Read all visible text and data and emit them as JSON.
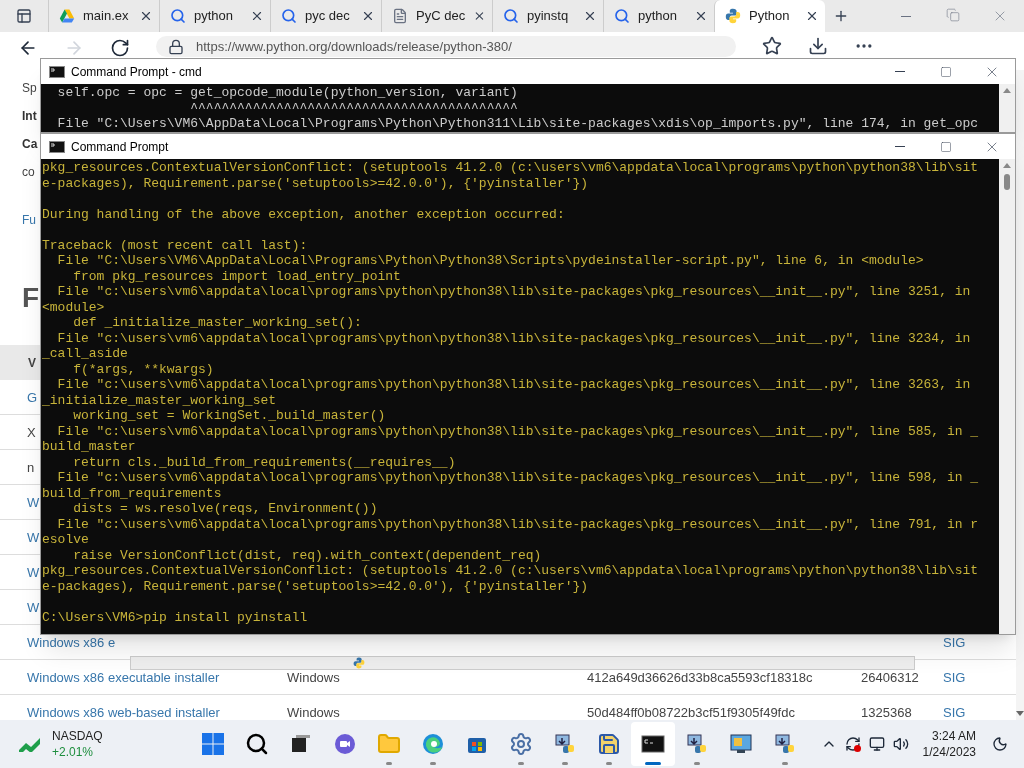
{
  "browser": {
    "tabs": [
      {
        "title": "main.ex",
        "kind": "drive",
        "selected": false
      },
      {
        "title": "python",
        "kind": "search",
        "selected": false
      },
      {
        "title": "pyc dec",
        "kind": "search",
        "selected": false
      },
      {
        "title": "PyC dec",
        "kind": "page",
        "selected": false
      },
      {
        "title": "pyinstq",
        "kind": "search",
        "selected": false
      },
      {
        "title": "python",
        "kind": "search",
        "selected": false
      },
      {
        "title": "Python",
        "kind": "python",
        "selected": true
      }
    ],
    "url": "https://www.python.org/downloads/release/python-380/",
    "page": {
      "paragraphs": [
        {
          "text": "Sp",
          "kind": "text"
        },
        {
          "text": "Int",
          "kind": "bold"
        },
        {
          "text": "Ca",
          "kind": "bold"
        },
        {
          "text": "co",
          "kind": "text"
        },
        {
          "text": "Fu",
          "kind": "link"
        }
      ],
      "heading": "F",
      "table": {
        "header": "V",
        "rows": [
          {
            "cells": [
              {
                "text": "G",
                "kind": "link"
              }
            ]
          },
          {
            "cells": [
              {
                "text": "X",
                "kind": "text"
              }
            ]
          },
          {
            "cells": [
              {
                "text": "n",
                "kind": "text"
              }
            ]
          },
          {
            "cells": [
              {
                "text": "W",
                "kind": "link"
              }
            ]
          },
          {
            "cells": [
              {
                "text": "W",
                "kind": "link"
              }
            ]
          },
          {
            "cells": [
              {
                "text": "W",
                "kind": "link"
              }
            ]
          },
          {
            "cells": [
              {
                "text": "W",
                "kind": "link"
              }
            ]
          },
          {
            "cells": [
              {
                "text": "Windows x86 e",
                "kind": "link"
              },
              {
                "text": "",
                "kind": "gap"
              },
              {
                "text": "",
                "kind": "gap"
              },
              {
                "text": "",
                "kind": "gap"
              },
              {
                "text": "",
                "kind": "gap"
              },
              {
                "text": "SIG",
                "kind": "link"
              }
            ]
          },
          {
            "cells": [
              {
                "text": "Windows x86 executable installer",
                "kind": "link"
              },
              {
                "text": "Windows",
                "kind": "text"
              },
              {
                "text": "",
                "kind": "gap"
              },
              {
                "text": "412a649d36626d33b8ca5593cf18318c",
                "kind": "text"
              },
              {
                "text": "26406312",
                "kind": "text"
              },
              {
                "text": "SIG",
                "kind": "link"
              }
            ]
          },
          {
            "cells": [
              {
                "text": "Windows x86 web-based installer",
                "kind": "link"
              },
              {
                "text": "Windows",
                "kind": "text"
              },
              {
                "text": "",
                "kind": "gap"
              },
              {
                "text": "50d484ff0b08722b3cf51f9305f49fdc",
                "kind": "text"
              },
              {
                "text": "1325368",
                "kind": "text"
              },
              {
                "text": "SIG",
                "kind": "link"
              }
            ]
          }
        ]
      }
    }
  },
  "windows": [
    {
      "title": "Command Prompt - cmd",
      "kind": "back",
      "blocks": [
        [
          "  self.opc = opc = get_opcode_module(python_version, variant)",
          "                   ^^^^^^^^^^^^^^^^^^^^^^^^^^^^^^^^^^^^^^^^^^",
          "  File \"C:\\Users\\VM6\\AppData\\Local\\Programs\\Python\\Python311\\Lib\\site-packages\\xdis\\op_imports.py\", line 174, in get_opc"
        ]
      ]
    },
    {
      "title": "Command Prompt",
      "kind": "front",
      "blocks": [
        [
          "pkg_resources.ContextualVersionConflict: (setuptools 41.2.0 (c:\\users\\vm6\\appdata\\local\\programs\\python\\python38\\lib\\sit",
          "e-packages), Requirement.parse('setuptools>=42.0.0'), {'pyinstaller'})"
        ],
        [
          "During handling of the above exception, another exception occurred:"
        ],
        [
          "Traceback (most recent call last):",
          "  File \"C:\\Users\\VM6\\AppData\\Local\\Programs\\Python\\Python38\\Scripts\\pydeinstaller-script.py\", line 6, in <module>",
          "    from pkg_resources import load_entry_point",
          "  File \"c:\\users\\vm6\\appdata\\local\\programs\\python\\python38\\lib\\site-packages\\pkg_resources\\__init__.py\", line 3251, in",
          "<module>",
          "    def _initialize_master_working_set():",
          "  File \"c:\\users\\vm6\\appdata\\local\\programs\\python\\python38\\lib\\site-packages\\pkg_resources\\__init__.py\", line 3234, in",
          "_call_aside",
          "    f(*args, **kwargs)",
          "  File \"c:\\users\\vm6\\appdata\\local\\programs\\python\\python38\\lib\\site-packages\\pkg_resources\\__init__.py\", line 3263, in",
          "_initialize_master_working_set",
          "    working_set = WorkingSet._build_master()",
          "  File \"c:\\users\\vm6\\appdata\\local\\programs\\python\\python38\\lib\\site-packages\\pkg_resources\\__init__.py\", line 585, in _",
          "build_master",
          "    return cls._build_from_requirements(__requires__)",
          "  File \"c:\\users\\vm6\\appdata\\local\\programs\\python\\python38\\lib\\site-packages\\pkg_resources\\__init__.py\", line 598, in _",
          "build_from_requirements",
          "    dists = ws.resolve(reqs, Environment())",
          "  File \"c:\\users\\vm6\\appdata\\local\\programs\\python\\python38\\lib\\site-packages\\pkg_resources\\__init__.py\", line 791, in r",
          "esolve",
          "    raise VersionConflict(dist, req).with_context(dependent_req)",
          "pkg_resources.ContextualVersionConflict: (setuptools 41.2.0 (c:\\users\\vm6\\appdata\\local\\programs\\python\\python38\\lib\\sit",
          "e-packages), Requirement.parse('setuptools>=42.0.0'), {'pyinstaller'})"
        ],
        [
          "C:\\Users\\VM6>pip install pyinstall"
        ]
      ]
    }
  ],
  "taskbar": {
    "widget": {
      "name": "NASDAQ",
      "change": "+2.01%"
    },
    "apps": [
      {
        "kind": "start",
        "running": false,
        "selected": false
      },
      {
        "kind": "search",
        "running": false,
        "selected": false
      },
      {
        "kind": "taskview",
        "running": false,
        "selected": false
      },
      {
        "kind": "chat",
        "running": false,
        "selected": false
      },
      {
        "kind": "explorer",
        "running": true,
        "selected": false
      },
      {
        "kind": "edge",
        "running": true,
        "selected": false
      },
      {
        "kind": "store",
        "running": false,
        "selected": false
      },
      {
        "kind": "settings",
        "running": true,
        "selected": false
      },
      {
        "kind": "installer",
        "running": true,
        "selected": false
      },
      {
        "kind": "disk",
        "running": true,
        "selected": false
      },
      {
        "kind": "terminal",
        "running": true,
        "selected": true
      },
      {
        "kind": "installer",
        "running": true,
        "selected": false
      },
      {
        "kind": "panel",
        "running": false,
        "selected": false
      },
      {
        "kind": "installer",
        "running": true,
        "selected": false
      }
    ],
    "clock": {
      "time": "3:24 AM",
      "date": "1/24/2023"
    }
  }
}
